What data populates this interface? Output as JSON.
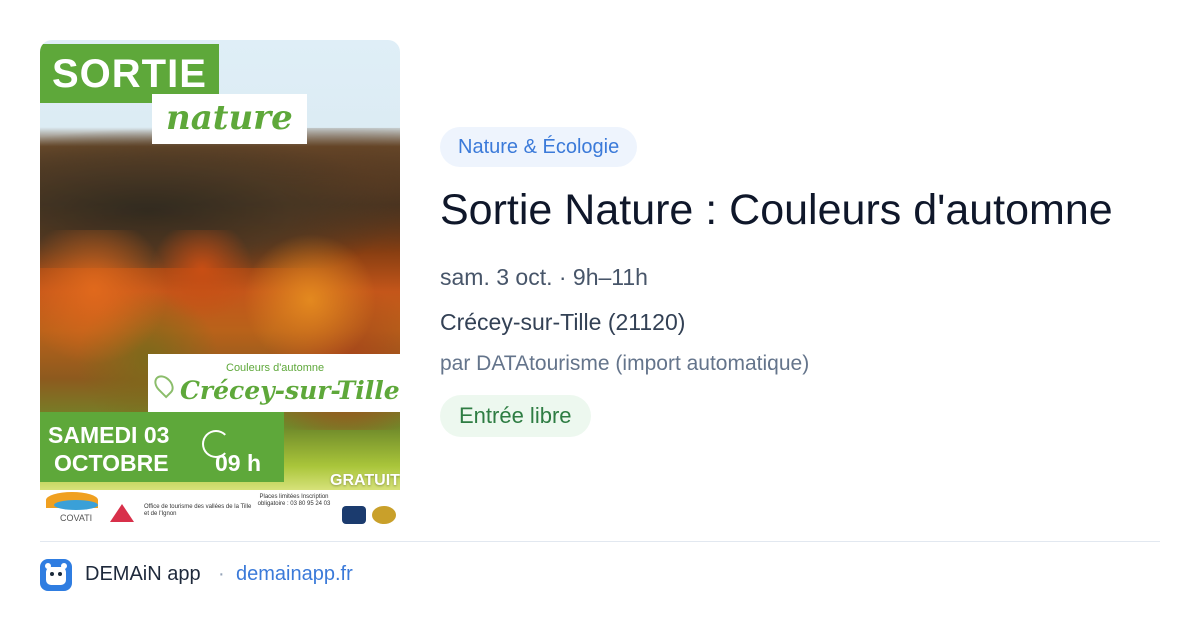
{
  "poster": {
    "title_line1": "SORTIE",
    "title_line2": "nature",
    "subtitle": "Couleurs d'automne",
    "location": "Crécey-sur-Tille",
    "date_line1": "SAMEDI 03",
    "date_line2": "OCTOBRE",
    "time": "09 h",
    "price_badge": "GRATUIT",
    "logo_text": "COVATI",
    "office_text": "Office de tourisme des vallées de la Tille et de l'Ignon",
    "places_text": "Places limitées Inscription obligatoire : 03 80 95 24 03"
  },
  "event": {
    "category": "Nature & Écologie",
    "title": "Sortie Nature : Couleurs d'automne",
    "date_time": "sam. 3 oct. · 9h–11h",
    "place": "Crécey-sur-Tille (21120)",
    "source": "par DATAtourisme (import automatique)",
    "price": "Entrée libre"
  },
  "footer": {
    "app_name": "DEMAiN app",
    "separator": "·",
    "domain": "demainapp.fr",
    "icon": "app-logo-icon"
  },
  "colors": {
    "accent_blue": "#3b7ad9",
    "poster_green": "#5ea83a",
    "price_green": "#2e7d43"
  }
}
